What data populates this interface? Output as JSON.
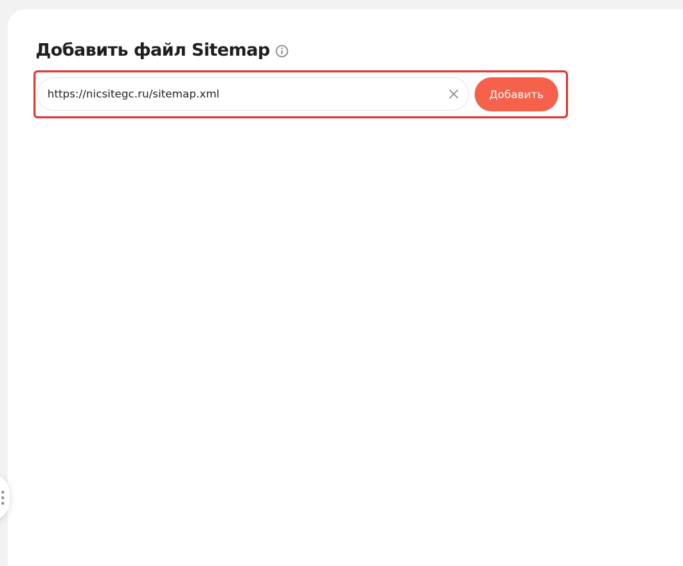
{
  "section": {
    "title": "Добавить файл Sitemap",
    "info_icon": "info-circle-icon"
  },
  "sitemap_form": {
    "input_value": "https://nicsitegc.ru/sitemap.xml",
    "clear_icon": "close-icon",
    "add_label": "Добавить"
  },
  "colors": {
    "accent": "#f5614b",
    "highlight_border": "#df3a36",
    "background": "#f2f2f2"
  },
  "side_handle": {
    "icon": "drag-handle-icon"
  }
}
